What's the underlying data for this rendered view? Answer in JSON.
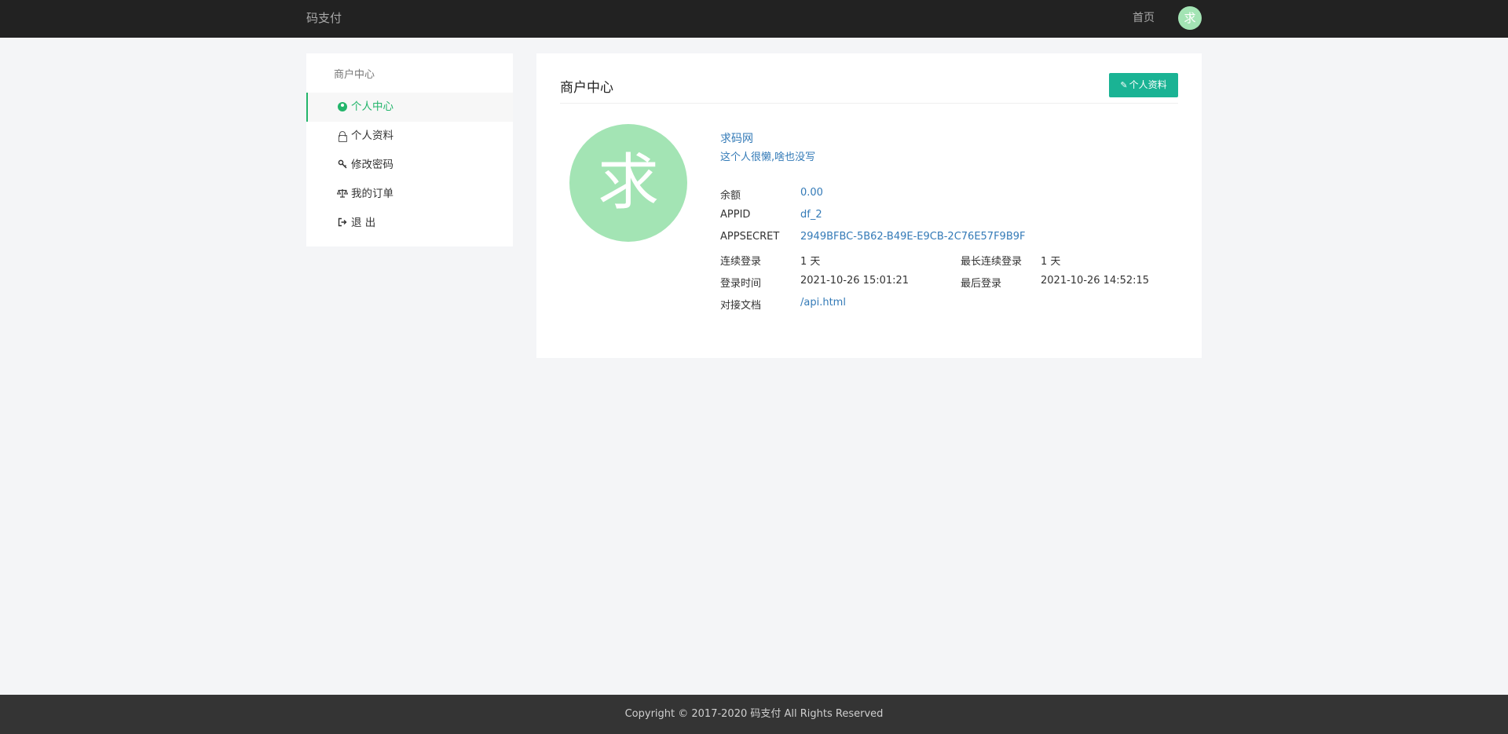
{
  "navbar": {
    "brand": "码支付",
    "home": "首页",
    "avatar_char": "求"
  },
  "sidebar": {
    "title": "商户中心",
    "items": [
      {
        "label": "个人中心",
        "icon": "user-circle-icon",
        "active": true
      },
      {
        "label": "个人资料",
        "icon": "lock-icon",
        "active": false
      },
      {
        "label": "修改密码",
        "icon": "key-icon",
        "active": false
      },
      {
        "label": "我的订单",
        "icon": "balance-scale-icon",
        "active": false
      },
      {
        "label": "退 出",
        "icon": "sign-out-icon",
        "active": false
      }
    ]
  },
  "main": {
    "title": "商户中心",
    "profile_button": "个人资料",
    "avatar_char": "求",
    "user_name": "求码网",
    "user_bio": "这个人很懒,啥也没写",
    "info": {
      "balance_label": "余额",
      "balance": "0.00",
      "appid_label": "APPID",
      "appid": "df_2",
      "appsecret_label": "APPSECRET",
      "appsecret": "2949BFBC-5B62-B49E-E9CB-2C76E57F9B9F",
      "continuous_login_label": "连续登录",
      "continuous_login": "1 天",
      "longest_login_label": "最长连续登录",
      "longest_login": "1 天",
      "login_time_label": "登录时间",
      "login_time": "2021-10-26 15:01:21",
      "last_login_label": "最后登录",
      "last_login": "2021-10-26 14:52:15",
      "docs_label": "对接文档",
      "docs": "/api.html"
    }
  },
  "footer": {
    "copyright": "Copyright © 2017-2020 码支付 All Rights Reserved"
  },
  "colors": {
    "accent": "#23b56b",
    "button": "#1ab394",
    "link": "#337ab7",
    "avatar": "#a3e4b4",
    "navbar": "#222222",
    "footer": "#343434"
  }
}
